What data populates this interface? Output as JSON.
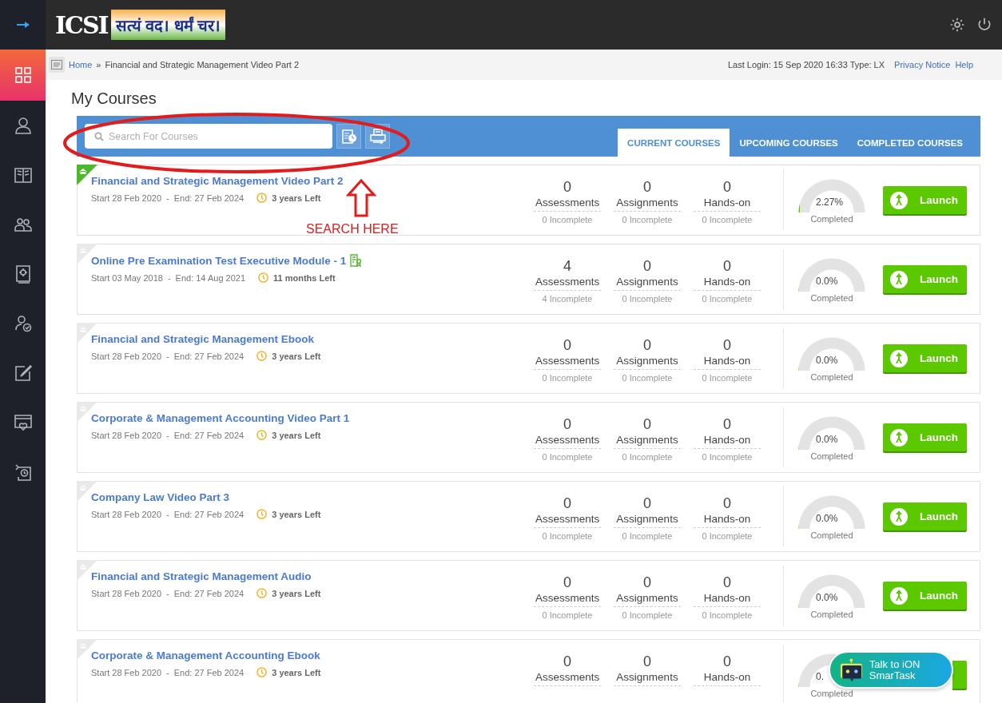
{
  "header": {
    "logo_text": "ICSI",
    "motto": "सत्यं वद। धर्मं चर।"
  },
  "sidebar": {
    "items": [
      {
        "selected": true
      },
      {
        "selected": false
      },
      {
        "selected": false
      },
      {
        "selected": false
      },
      {
        "selected": false
      },
      {
        "selected": false
      },
      {
        "selected": false
      },
      {
        "selected": false
      },
      {
        "selected": false
      }
    ]
  },
  "breadcrumb": {
    "home": "Home",
    "separator": "»",
    "current": "Financial and Strategic Management Video Part 2",
    "last_login": "Last Login: 15 Sep 2020 16:33 Type: LX",
    "links": [
      "Privacy Notice",
      "Help"
    ]
  },
  "page_title": "My Courses",
  "search": {
    "placeholder": "Search For Courses"
  },
  "tabs": [
    {
      "label": "CURRENT COURSES",
      "selected": true
    },
    {
      "label": "UPCOMING COURSES",
      "selected": false
    },
    {
      "label": "COMPLETED COURSES",
      "selected": false
    }
  ],
  "annotation": {
    "label": "SEARCH HERE"
  },
  "courses": [
    {
      "title": "Financial and Strategic Management Video Part 2",
      "pinned": true,
      "certificate": false,
      "start": "Start 28 Feb 2020",
      "separator": "-",
      "end": "End: 27 Feb 2024",
      "left": "3 years Left",
      "stats": [
        {
          "count": "0",
          "label": "Assessments",
          "incomplete": "0 Incomplete"
        },
        {
          "count": "0",
          "label": "Assignments",
          "incomplete": "0 Incomplete"
        },
        {
          "count": "0",
          "label": "Hands-on",
          "incomplete": "0 Incomplete"
        }
      ],
      "percent": "2.27%",
      "level": 0.0227,
      "completed": "Completed",
      "launch": "Launch"
    },
    {
      "title": "Online Pre Examination Test Executive Module - 1",
      "pinned": false,
      "certificate": true,
      "start": "Start 03 May 2018",
      "separator": "-",
      "end": "End: 14 Aug 2021",
      "left": "11 months Left",
      "stats": [
        {
          "count": "4",
          "label": "Assessments",
          "incomplete": "4 Incomplete"
        },
        {
          "count": "0",
          "label": "Assignments",
          "incomplete": "0 Incomplete"
        },
        {
          "count": "0",
          "label": "Hands-on",
          "incomplete": "0 Incomplete"
        }
      ],
      "percent": "0.0%",
      "level": 0,
      "completed": "Completed",
      "launch": "Launch"
    },
    {
      "title": "Financial and Strategic Management Ebook",
      "pinned": false,
      "certificate": false,
      "start": "Start 28 Feb 2020",
      "separator": "-",
      "end": "End: 27 Feb 2024",
      "left": "3 years Left",
      "stats": [
        {
          "count": "0",
          "label": "Assessments",
          "incomplete": "0 Incomplete"
        },
        {
          "count": "0",
          "label": "Assignments",
          "incomplete": "0 Incomplete"
        },
        {
          "count": "0",
          "label": "Hands-on",
          "incomplete": "0 Incomplete"
        }
      ],
      "percent": "0.0%",
      "level": 0,
      "completed": "Completed",
      "launch": "Launch"
    },
    {
      "title": "Corporate & Management Accounting Video Part 1",
      "pinned": false,
      "certificate": false,
      "start": "Start 28 Feb 2020",
      "separator": "-",
      "end": "End: 27 Feb 2024",
      "left": "3 years Left",
      "stats": [
        {
          "count": "0",
          "label": "Assessments",
          "incomplete": "0 Incomplete"
        },
        {
          "count": "0",
          "label": "Assignments",
          "incomplete": "0 Incomplete"
        },
        {
          "count": "0",
          "label": "Hands-on",
          "incomplete": "0 Incomplete"
        }
      ],
      "percent": "0.0%",
      "level": 0,
      "completed": "Completed",
      "launch": "Launch"
    },
    {
      "title": "Company Law Video Part 3",
      "pinned": false,
      "certificate": false,
      "start": "Start 28 Feb 2020",
      "separator": "-",
      "end": "End: 27 Feb 2024",
      "left": "3 years Left",
      "stats": [
        {
          "count": "0",
          "label": "Assessments",
          "incomplete": "0 Incomplete"
        },
        {
          "count": "0",
          "label": "Assignments",
          "incomplete": "0 Incomplete"
        },
        {
          "count": "0",
          "label": "Hands-on",
          "incomplete": "0 Incomplete"
        }
      ],
      "percent": "0.0%",
      "level": 0,
      "completed": "Completed",
      "launch": "Launch"
    },
    {
      "title": "Financial and Strategic Management Audio",
      "pinned": false,
      "certificate": false,
      "start": "Start 28 Feb 2020",
      "separator": "-",
      "end": "End: 27 Feb 2024",
      "left": "3 years Left",
      "stats": [
        {
          "count": "0",
          "label": "Assessments",
          "incomplete": "0 Incomplete"
        },
        {
          "count": "0",
          "label": "Assignments",
          "incomplete": "0 Incomplete"
        },
        {
          "count": "0",
          "label": "Hands-on",
          "incomplete": "0 Incomplete"
        }
      ],
      "percent": "0.0%",
      "level": 0,
      "completed": "Completed",
      "launch": "Launch"
    },
    {
      "title": "Corporate & Management Accounting Ebook",
      "pinned": false,
      "certificate": false,
      "start": "Start 28 Feb 2020",
      "separator": "-",
      "end": "End: 27 Feb 2024",
      "left": "3 years Left",
      "stats": [
        {
          "count": "0",
          "label": "Assessments"
        },
        {
          "count": "0",
          "label": "Assignments"
        },
        {
          "count": "0",
          "label": "Hands-on"
        }
      ],
      "percent": "0.",
      "level": 0,
      "completed": "Completed"
    }
  ],
  "chat": {
    "label": "Talk to iON SmarTask"
  }
}
